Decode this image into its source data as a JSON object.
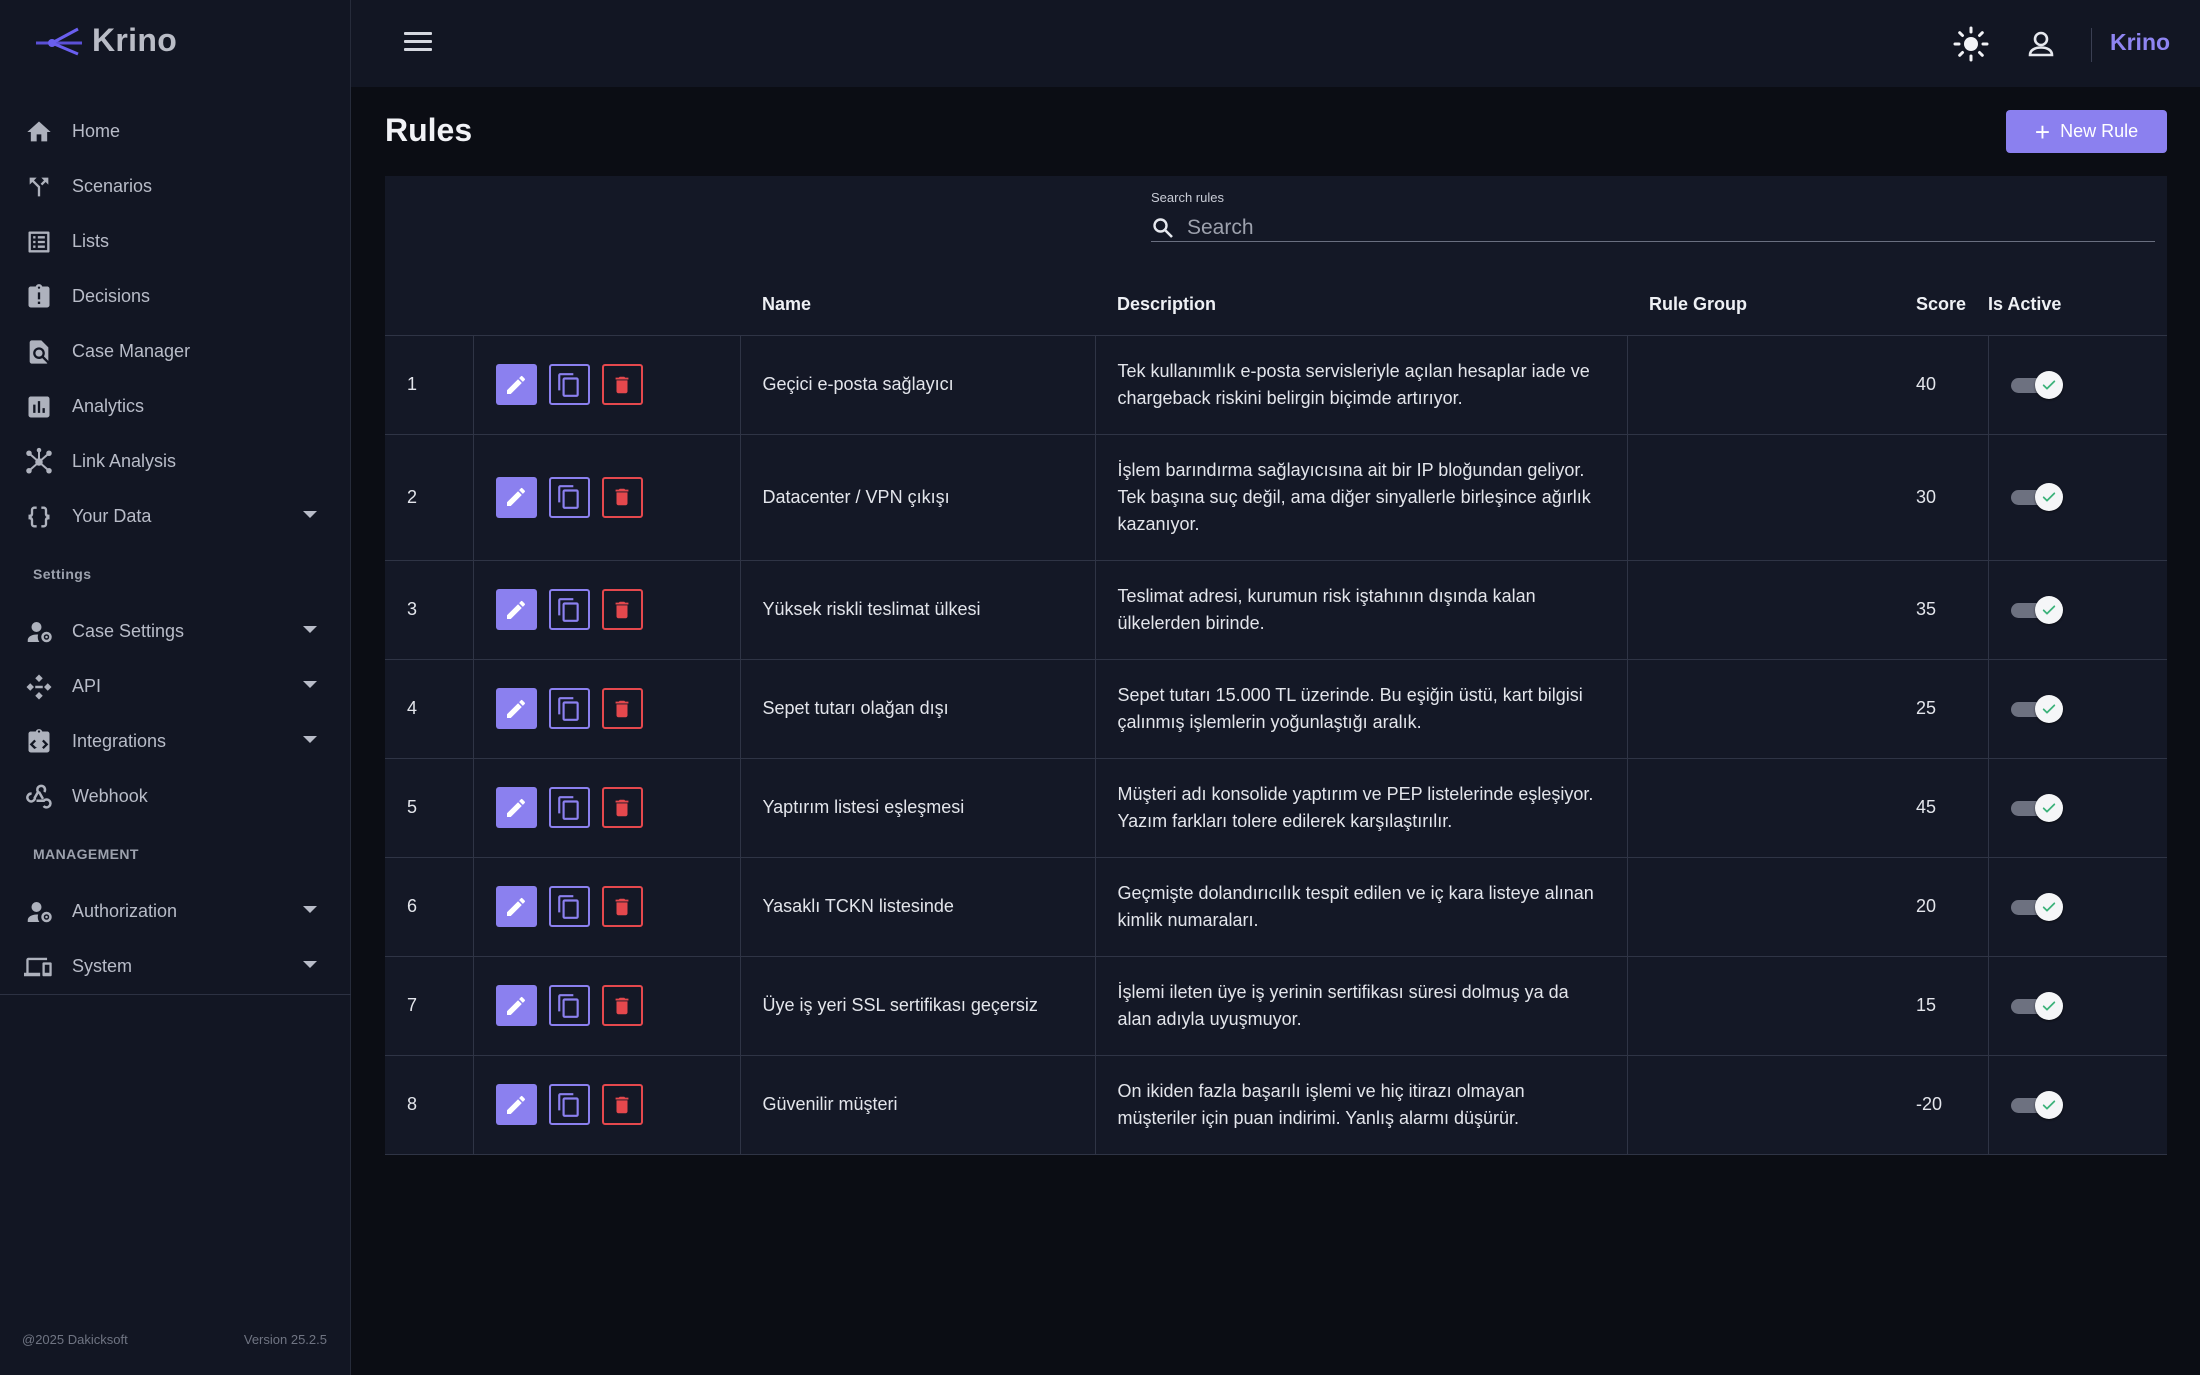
{
  "brand": {
    "name": "Krino",
    "accent": "#8b80ef"
  },
  "sidebar": {
    "items": [
      {
        "label": "Home",
        "icon": "home-icon"
      },
      {
        "label": "Scenarios",
        "icon": "fork-icon"
      },
      {
        "label": "Lists",
        "icon": "list-icon"
      },
      {
        "label": "Decisions",
        "icon": "clipboard-alert-icon"
      },
      {
        "label": "Case Manager",
        "icon": "file-search-icon"
      },
      {
        "label": "Analytics",
        "icon": "bar-chart-icon"
      },
      {
        "label": "Link Analysis",
        "icon": "hub-icon"
      },
      {
        "label": "Your Data",
        "icon": "braces-icon"
      }
    ],
    "settings_title": "Settings",
    "settings_items": [
      {
        "label": "Case Settings",
        "icon": "user-gear-icon"
      },
      {
        "label": "API",
        "icon": "api-icon"
      },
      {
        "label": "Integrations",
        "icon": "integration-icon"
      },
      {
        "label": "Webhook",
        "icon": "webhook-icon"
      }
    ],
    "management_title": "MANAGEMENT",
    "management_items": [
      {
        "label": "Authorization",
        "icon": "user-gear-icon"
      },
      {
        "label": "System",
        "icon": "devices-icon"
      }
    ],
    "footer": {
      "copyright": "@2025 Dakicksoft",
      "version": "Version 25.2.5"
    }
  },
  "topbar": {
    "brand": "Krino"
  },
  "page": {
    "title": "Rules",
    "new_button": "New Rule"
  },
  "search": {
    "label": "Search rules",
    "placeholder": "Search"
  },
  "table": {
    "columns": [
      "",
      "",
      "Name",
      "Description",
      "Rule Group",
      "Score",
      "Is Active"
    ],
    "rows": [
      {
        "index": "1",
        "name": "Geçici e-posta sağlayıcı",
        "description": "Tek kullanımlık e-posta servisleriyle açılan hesaplar iade ve chargeback riskini belirgin biçimde artırıyor.",
        "group": "",
        "score": "40",
        "active": true
      },
      {
        "index": "2",
        "name": "Datacenter / VPN çıkışı",
        "description": "İşlem barındırma sağlayıcısına ait bir IP bloğundan geliyor. Tek başına suç değil, ama diğer sinyallerle birleşince ağırlık kazanıyor.",
        "group": "",
        "score": "30",
        "active": true
      },
      {
        "index": "3",
        "name": "Yüksek riskli teslimat ülkesi",
        "description": "Teslimat adresi, kurumun risk iştahının dışında kalan ülkelerden birinde.",
        "group": "",
        "score": "35",
        "active": true
      },
      {
        "index": "4",
        "name": "Sepet tutarı olağan dışı",
        "description": "Sepet tutarı 15.000 TL üzerinde. Bu eşiğin üstü, kart bilgisi çalınmış işlemlerin yoğunlaştığı aralık.",
        "group": "",
        "score": "25",
        "active": true
      },
      {
        "index": "5",
        "name": "Yaptırım listesi eşleşmesi",
        "description": "Müşteri adı konsolide yaptırım ve PEP listelerinde eşleşiyor. Yazım farkları tolere edilerek karşılaştırılır.",
        "group": "",
        "score": "45",
        "active": true
      },
      {
        "index": "6",
        "name": "Yasaklı TCKN listesinde",
        "description": "Geçmişte dolandırıcılık tespit edilen ve iç kara listeye alınan kimlik numaraları.",
        "group": "",
        "score": "20",
        "active": true
      },
      {
        "index": "7",
        "name": "Üye iş yeri SSL sertifikası geçersiz",
        "description": "İşlemi ileten üye iş yerinin sertifikası süresi dolmuş ya da alan adıyla uyuşmuyor.",
        "group": "",
        "score": "15",
        "active": true
      },
      {
        "index": "8",
        "name": "Güvenilir müşteri",
        "description": "On ikiden fazla başarılı işlemi ve hiç itirazı olmayan müşteriler için puan indirimi. Yanlış alarmı düşürür.",
        "group": "",
        "score": "-20",
        "active": true
      }
    ]
  }
}
